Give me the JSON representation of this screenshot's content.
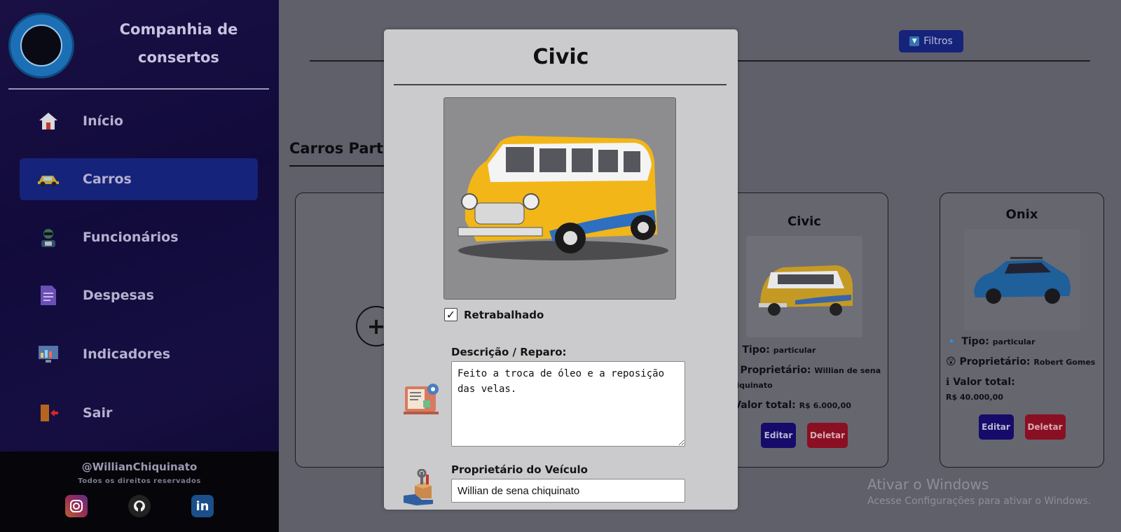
{
  "sidebar": {
    "brand": [
      "Companhia de",
      "consertos"
    ],
    "items": [
      {
        "label": "Início",
        "icon": "home-icon"
      },
      {
        "label": "Carros",
        "icon": "car-icon"
      },
      {
        "label": "Funcionários",
        "icon": "employee-icon"
      },
      {
        "label": "Despesas",
        "icon": "document-icon"
      },
      {
        "label": "Indicadores",
        "icon": "dashboard-icon"
      },
      {
        "label": "Sair",
        "icon": "exit-door-icon"
      }
    ],
    "active_index": 1,
    "footer": {
      "handle": "@WillianChiquinato",
      "rights": "Todos os direitos reservados",
      "socials": [
        "instagram-icon",
        "github-icon",
        "linkedin-icon"
      ]
    }
  },
  "main": {
    "filters_label": "Filtros",
    "section_title": "Carros Part",
    "cards": [
      {
        "title": "Civic",
        "tipo_label": "Tipo:",
        "tipo": "particular",
        "owner_label": "Proprietário:",
        "owner": "Willian de sena chiquinato",
        "valor_label": "Valor total:",
        "valor": "R$ 6.000,00",
        "edit": "Editar",
        "delete": "Deletar"
      },
      {
        "title": "Onix",
        "tipo_label": "Tipo:",
        "tipo": "particular",
        "owner_label": "Proprietário:",
        "owner": "Robert Gomes",
        "valor_label": "Valor total:",
        "valor": "R$ 40.000,00",
        "edit": "Editar",
        "delete": "Deletar"
      }
    ]
  },
  "modal": {
    "title": "Civic",
    "retrabalhado_label": "Retrabalhado",
    "retrabalhado_checked": true,
    "description_label": "Descrição / Reparo:",
    "description_value": "Feito a troca de óleo e a reposição das velas.",
    "owner_label": "Proprietário do Veículo",
    "owner_value": "Willian de sena chiquinato"
  },
  "windows_watermark": {
    "line1": "Ativar o Windows",
    "line2": "Acesse Configurações para ativar o Windows."
  },
  "colors": {
    "sidebar_active": "#16237a",
    "edit_button": "#160b6a",
    "delete_button": "#8b0f22",
    "modal_bg": "#cbcbcd"
  }
}
